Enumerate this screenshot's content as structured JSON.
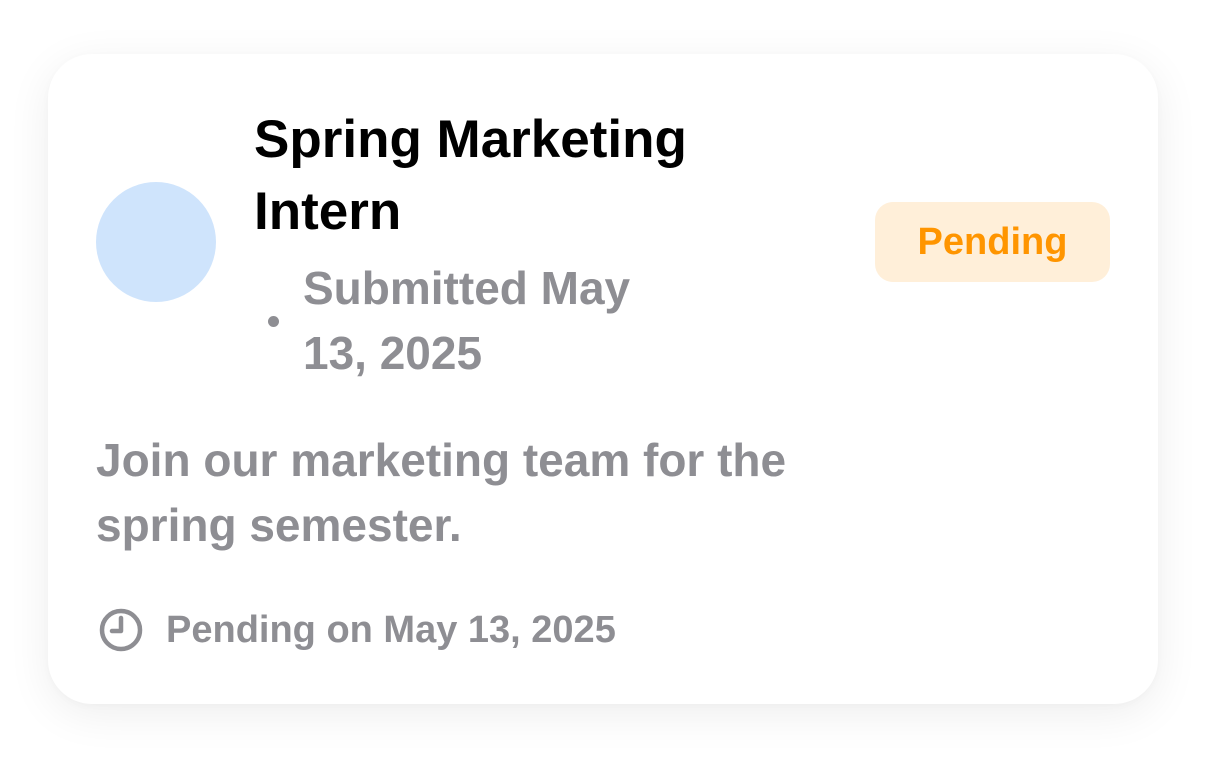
{
  "card": {
    "title": "Spring Marketing Intern",
    "submitted_text": "Submitted May 13, 2025",
    "status_badge": "Pending",
    "description": "Join our marketing team for the spring semester.",
    "footer_text": "Pending on May 13, 2025",
    "icons": {
      "avatar": "avatar-placeholder",
      "footer": "clock-icon"
    }
  },
  "colors": {
    "avatar": "#cfe4fc",
    "badge_bg": "#ffefd9",
    "badge_text": "#ff9500",
    "secondary_text": "#8e8e93",
    "title_text": "#000000"
  }
}
